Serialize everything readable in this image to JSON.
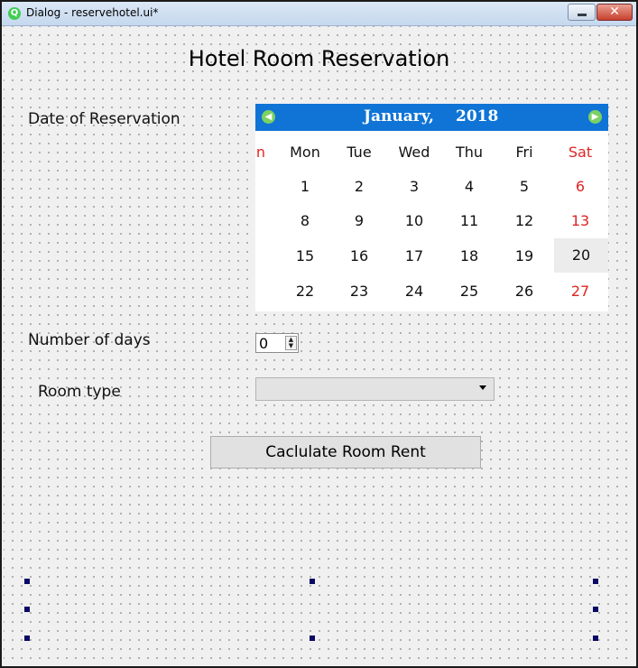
{
  "window": {
    "title": "Dialog - reservehotel.ui*"
  },
  "form": {
    "heading": "Hotel Room Reservation",
    "date_label": "Date of Reservation",
    "days_label": "Number of days",
    "room_type_label": "Room type",
    "days_value": "0",
    "room_type_value": "",
    "calc_button_label": "Caclulate Room Rent"
  },
  "calendar": {
    "month": "January,",
    "year": "2018",
    "partial_day_header": "n",
    "day_headers": [
      "Mon",
      "Tue",
      "Wed",
      "Thu",
      "Fri",
      "Sat"
    ],
    "weeks": [
      [
        "1",
        "2",
        "3",
        "4",
        "5",
        "6"
      ],
      [
        "8",
        "9",
        "10",
        "11",
        "12",
        "13"
      ],
      [
        "15",
        "16",
        "17",
        "18",
        "19",
        "20"
      ],
      [
        "22",
        "23",
        "24",
        "25",
        "26",
        "27"
      ]
    ],
    "selected_date": "20",
    "weekend_color": "#e02424",
    "header_color": "#0f74d6"
  }
}
